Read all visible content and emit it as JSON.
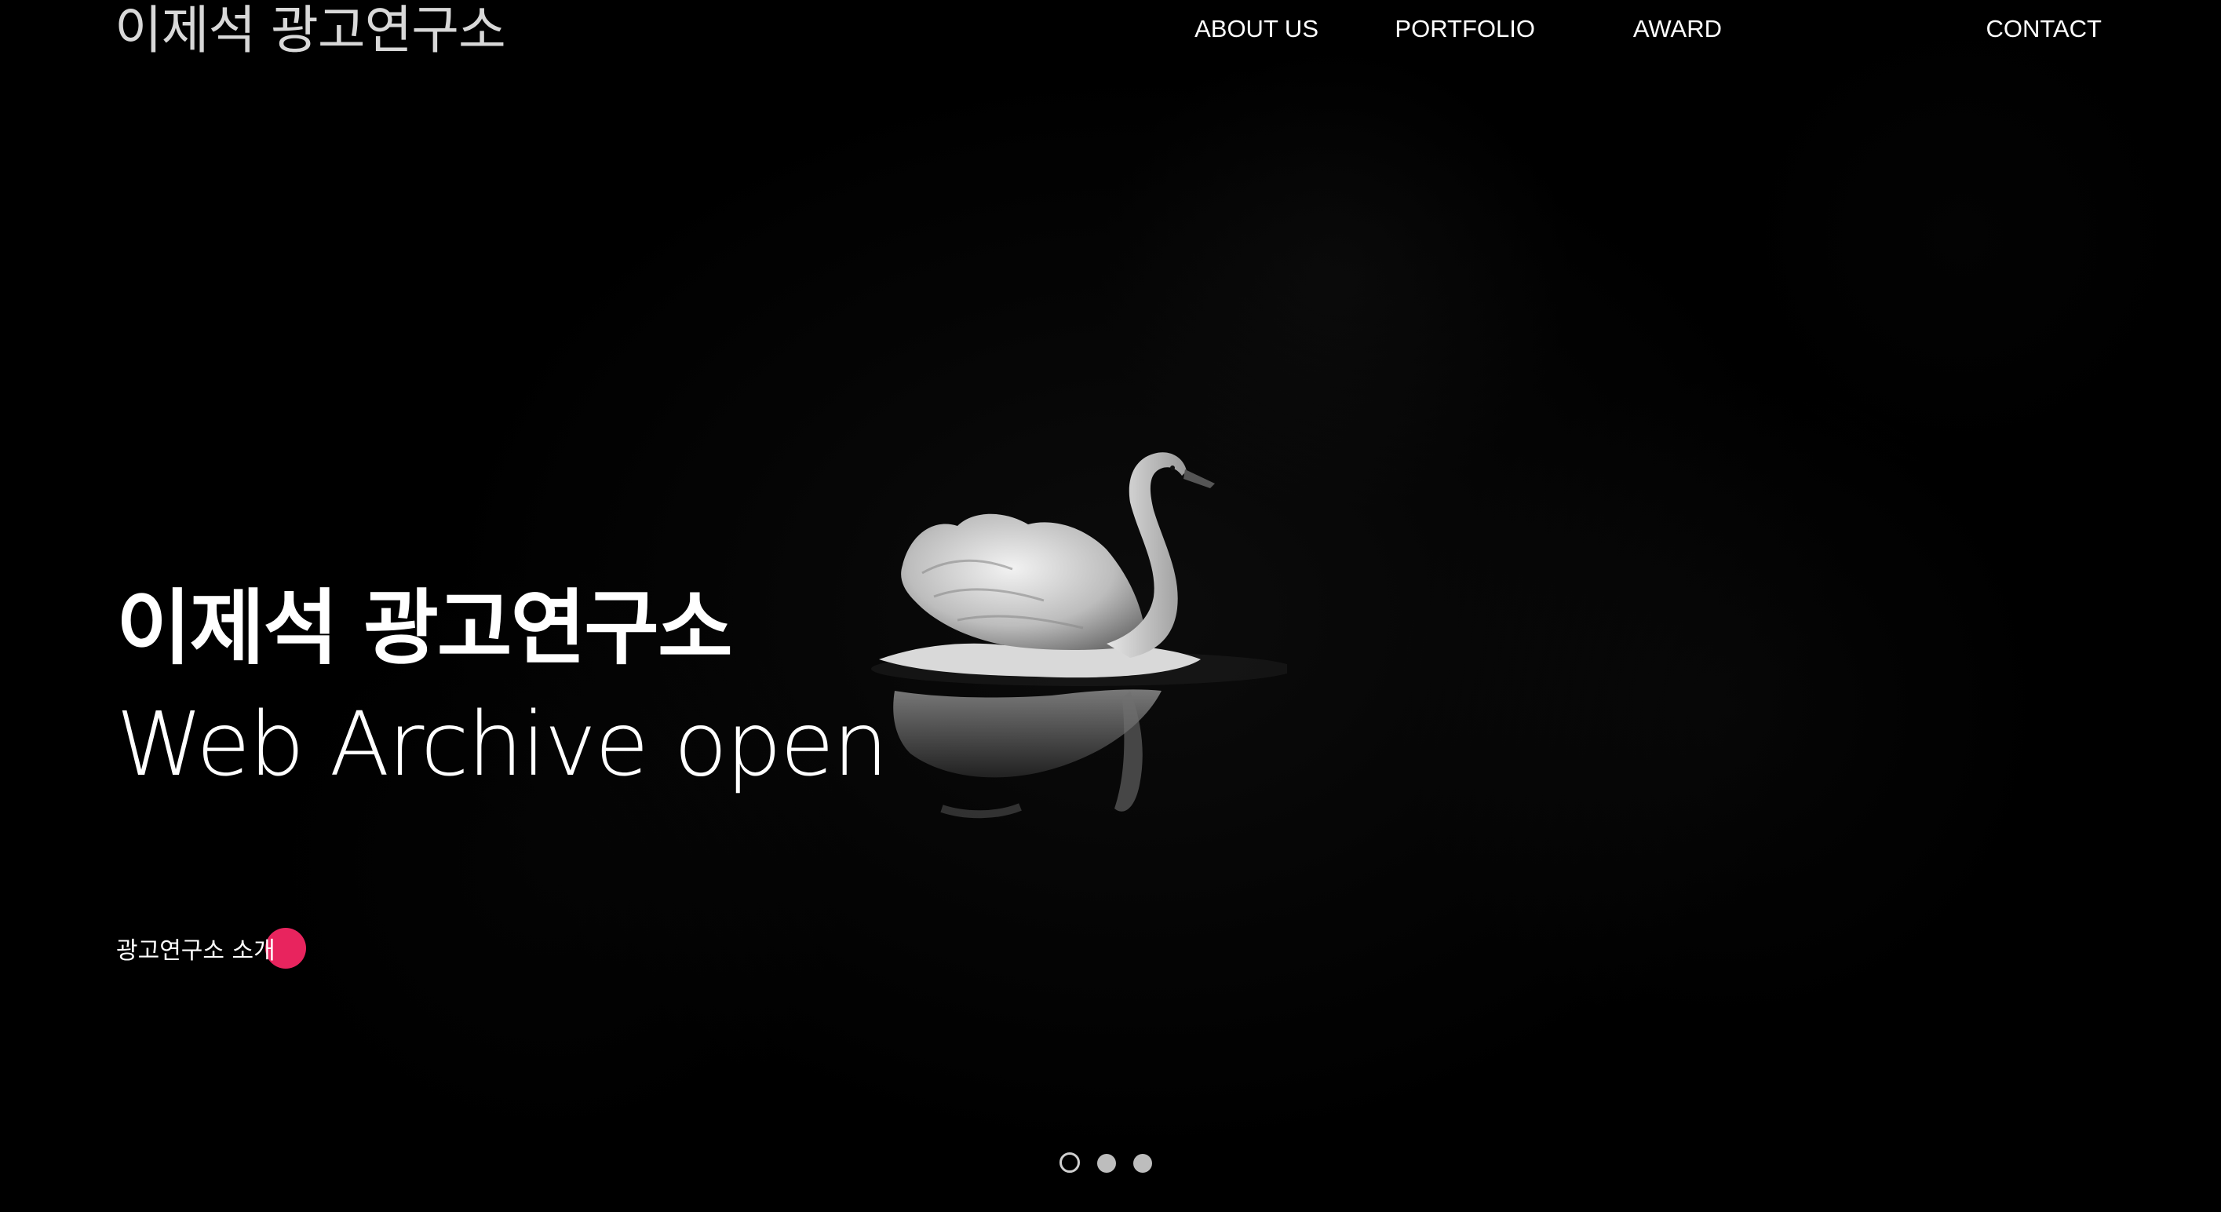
{
  "header": {
    "logo_text": "이제석 광고연구소",
    "nav": [
      {
        "label": "ABOUT US"
      },
      {
        "label": "PORTFOLIO"
      },
      {
        "label": "AWARD"
      },
      {
        "label": "CONTACT"
      }
    ]
  },
  "hero": {
    "title": "이제석 광고연구소",
    "subtitle": "Web Archive open",
    "cta_label": "광고연구소 소개",
    "accent_color": "#e8245e",
    "background_color": "#000000",
    "image_subject": "white-swan-on-dark-water"
  },
  "pagination": {
    "total": 3,
    "active": 1
  }
}
